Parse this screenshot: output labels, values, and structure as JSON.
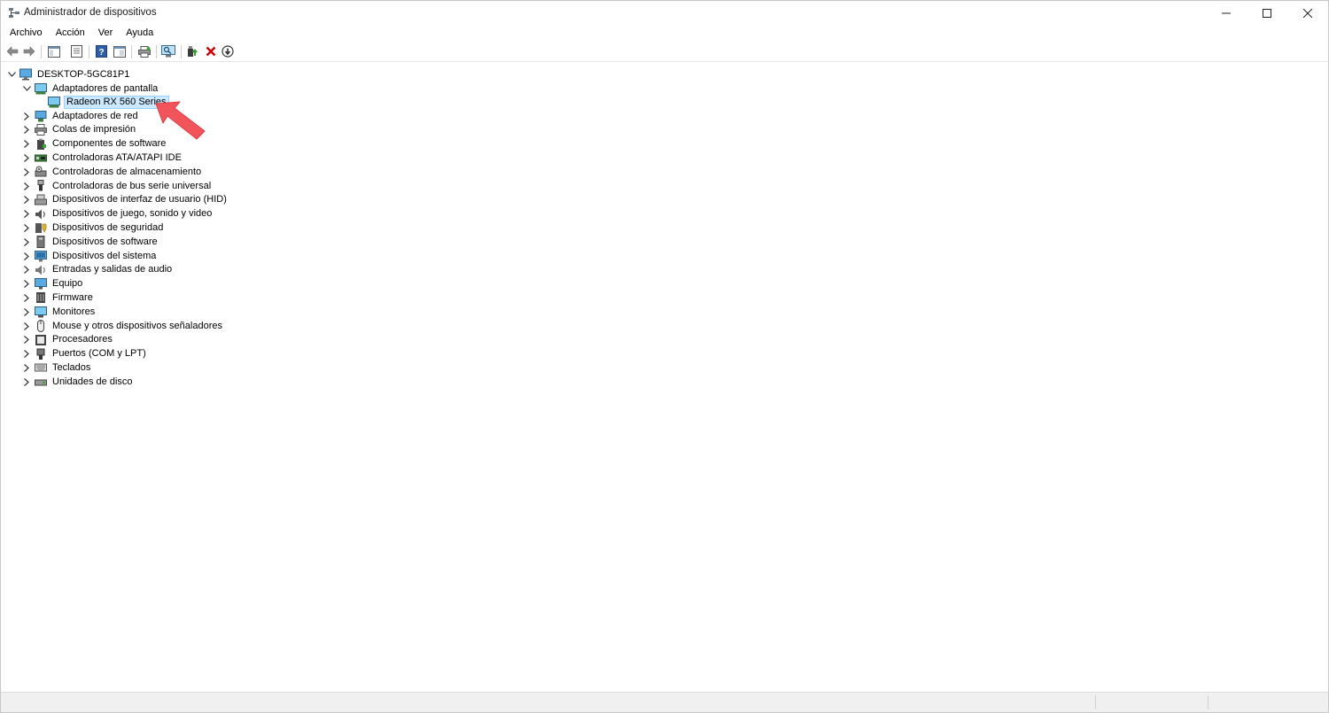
{
  "window": {
    "title": "Administrador de dispositivos",
    "icon": "device-manager-icon"
  },
  "menu": [
    "Archivo",
    "Acción",
    "Ver",
    "Ayuda"
  ],
  "toolbar_icons": [
    "back-arrow-icon",
    "forward-arrow-icon",
    "properties-panel-icon",
    "properties-page-icon",
    "help-icon",
    "show-hidden-icon",
    "print-icon",
    "scan-hardware-icon",
    "update-driver-icon",
    "uninstall-icon",
    "download-driver-icon"
  ],
  "tree": {
    "root": "DESKTOP-5GC81P1",
    "expanded_category": "Adaptadores de pantalla",
    "selected_child": "Radeon RX 560 Series",
    "categories": [
      "Adaptadores de red",
      "Colas de impresión",
      "Componentes de software",
      "Controladoras ATA/ATAPI IDE",
      "Controladoras de almacenamiento",
      "Controladoras de bus serie universal",
      "Dispositivos de interfaz de usuario (HID)",
      "Dispositivos de juego, sonido y video",
      "Dispositivos de seguridad",
      "Dispositivos de software",
      "Dispositivos del sistema",
      "Entradas y salidas de audio",
      "Equipo",
      "Firmware",
      "Monitores",
      "Mouse y otros dispositivos señaladores",
      "Procesadores",
      "Puertos (COM y LPT)",
      "Teclados",
      "Unidades de disco"
    ]
  },
  "colors": {
    "selection_bg": "#cce8ff",
    "selection_border": "#99d1ff",
    "annotation_arrow": "#f2545b",
    "uninstall_red": "#d10000"
  }
}
